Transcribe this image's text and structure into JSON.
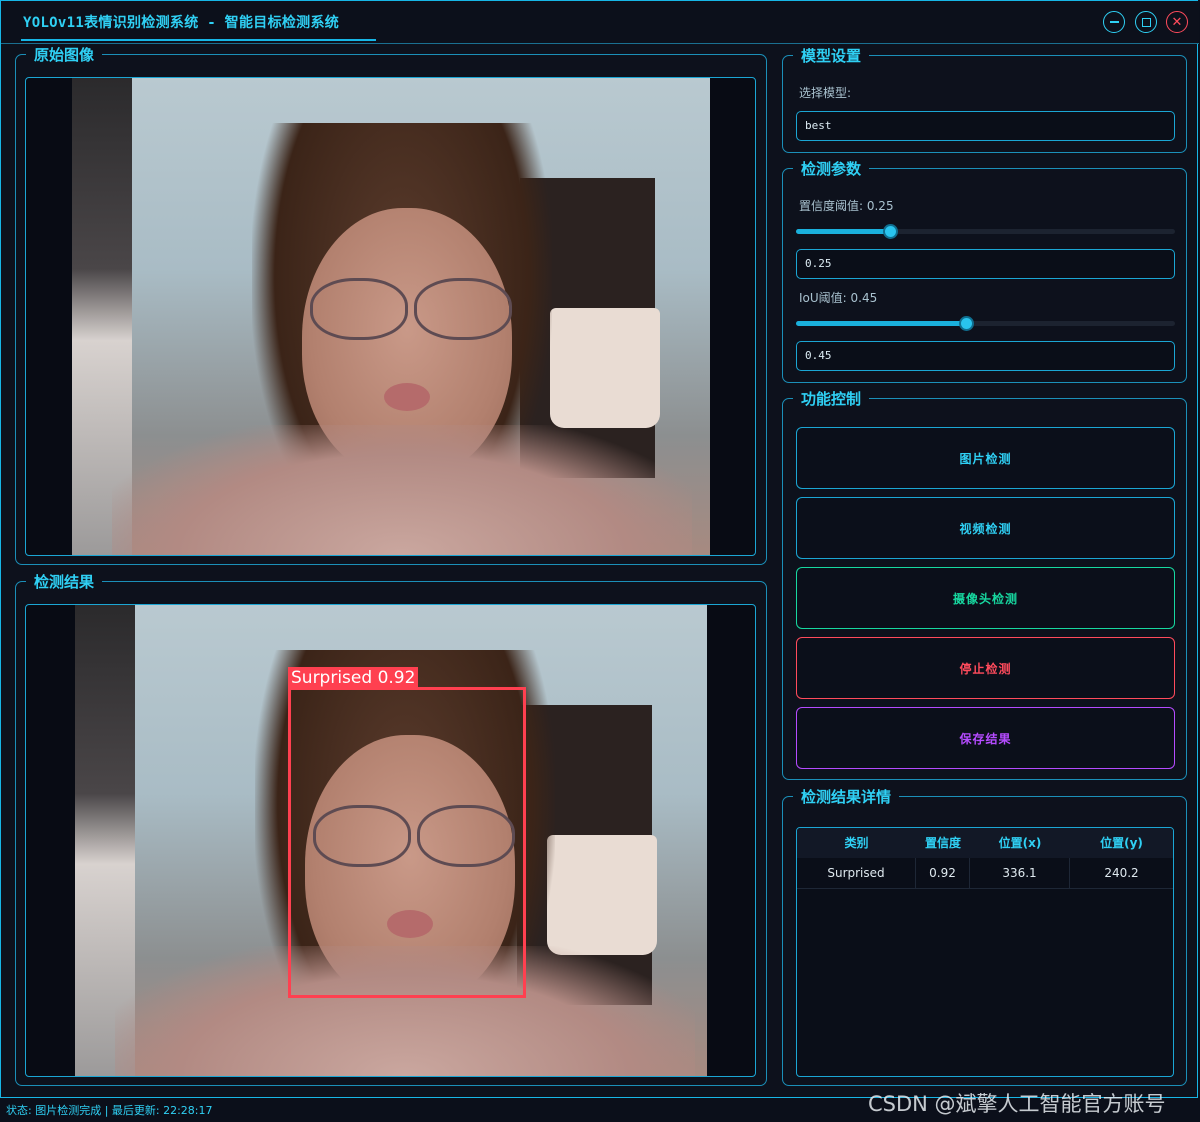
{
  "window": {
    "title": "YOLOv11表情识别检测系统 - 智能目标检测系统"
  },
  "panels": {
    "original_title": "原始图像",
    "result_title": "检测结果",
    "model_title": "模型设置",
    "params_title": "检测参数",
    "control_title": "功能控制",
    "details_title": "检测结果详情"
  },
  "model": {
    "select_label": "选择模型:",
    "selected": "best"
  },
  "params": {
    "conf_label": "置信度阈值: 0.25",
    "conf_value": "0.25",
    "conf_level": 0.25,
    "iou_label": "IoU阈值: 0.45",
    "iou_value": "0.45",
    "iou_level": 0.45
  },
  "controls": {
    "image_detect": "图片检测",
    "video_detect": "视频检测",
    "camera_detect": "摄像头检测",
    "stop_detect": "停止检测",
    "save_results": "保存结果"
  },
  "detection": {
    "label": "Surprised 0.92"
  },
  "table": {
    "headers": [
      "类别",
      "置信度",
      "位置(x)",
      "位置(y)"
    ],
    "rows": [
      [
        "Surprised",
        "0.92",
        "336.1",
        "240.2"
      ]
    ]
  },
  "status": {
    "text": "状态: 图片检测完成 | 最后更新: 22:28:17"
  },
  "watermark": "CSDN @斌擎人工智能官方账号",
  "colors": {
    "accent": "#2fd0f4",
    "camera_btn": "#17d8a0",
    "stop_btn": "#ff4b5c",
    "save_btn": "#b54bff",
    "bbox": "#ff4050"
  }
}
